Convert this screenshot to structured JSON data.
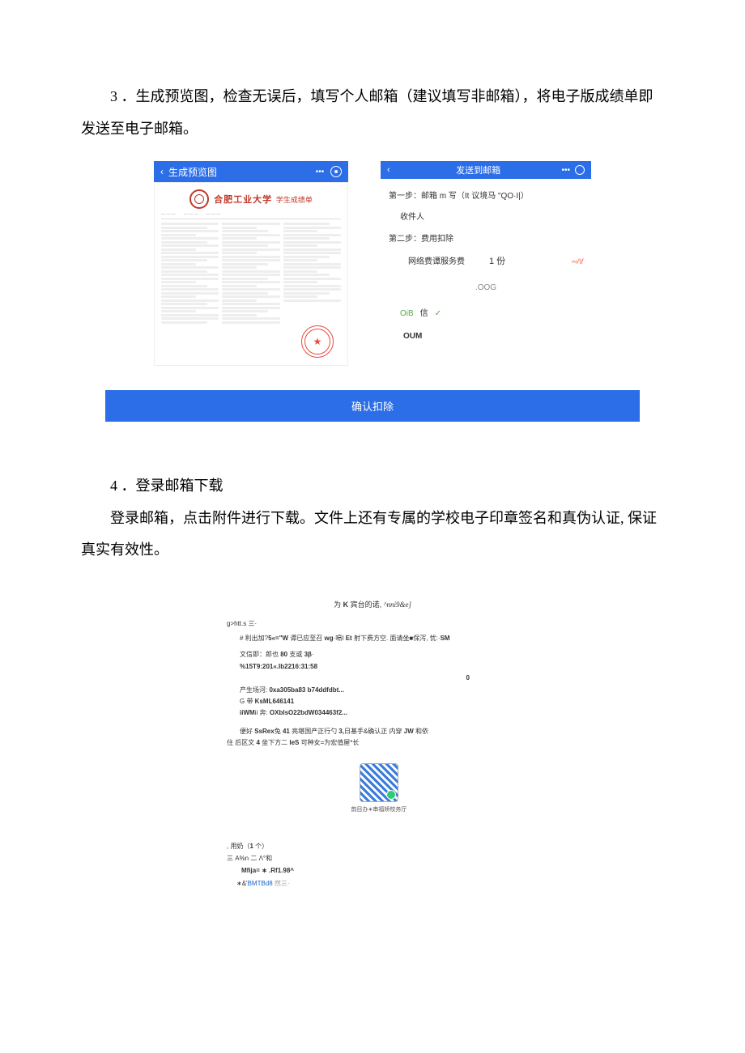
{
  "step3": {
    "para": "3 ．生成预览图，检查无误后，填写个人邮箱（建议填写非邮箱），将电子版成绩单即发送至电子邮箱。"
  },
  "preview": {
    "back": "‹",
    "header_title": "生成预览图",
    "dots": "•••",
    "university": "合肥工业大学",
    "sub": "学生成绩单"
  },
  "mail": {
    "back": "‹",
    "header_title": "发送到邮箱",
    "dots": "•••",
    "step1_label": "第一步：邮箱 m 写（It 议境马 \"QO·I|）",
    "recipient_label": "收件人",
    "step2_label": "第二步：费用扣除",
    "fee_name": "网络费谭服务费",
    "fee_qty": "1 份",
    "fee_price": "∾/\\f",
    "oog": ".OOG",
    "oib": "OiB",
    "oib_lab": "信",
    "check": "✓",
    "oum": "OUM"
  },
  "confirm_label": "确认扣除",
  "step4": {
    "title": "4 ．登录邮箱下载",
    "para": "登录邮箱，点击附件进行下载。文件上还有专属的学校电子印章签名和真伪认证, 保证真实有效性。"
  },
  "email": {
    "title_pre": "为",
    "title_k": "K",
    "title_mid": "宾台的诺,",
    "title_code": "^nni9&e]",
    "greet": "g>htt.s 三·",
    "line1_pre": "# 利出加?",
    "line1_b1": "5«=\"W",
    "line1_mid": " 谭已应至召 ",
    "line1_b2": "wg",
    "line1_mid2": "·嗝I ",
    "line1_b3": "Et",
    "line1_mid3": " 射下费方空. 面请坐■保泻, 忧:·",
    "line1_b4": "SM",
    "line2_pre": "文信即：郎也 ",
    "line2_b1": "80",
    "line2_mid": " 支或 ",
    "line2_b2": "3β",
    "line2_suf": "·",
    "line3": "%15T9:201«.Ib2216:31:58",
    "zero": "0",
    "line4_pre": "产生场河: ",
    "line4_b": "0xa305ba83 b74ddfdbt...",
    "line5_pre": "G 带 ",
    "line5_b": "KsML646141",
    "line6_pre": "iiWM",
    "line6_mid": "ii 奔: ",
    "line6_b": "OXblsO22bdW034463f2...",
    "line7_pre": "便好 ",
    "line7_b1": "SsRex",
    "line7_mid1": "兔 ",
    "line7_b2": "41",
    "line7_mid2": " 亮堪国产正行勺 ",
    "line7_b3": "3,",
    "line7_mid3": "日基手&确认正 内穿 ",
    "line7_b4": "JW",
    "line7_suf": " 和依",
    "line8_pre": "住 后区文 ",
    "line8_b1": "4",
    "line8_mid": " 坐下方二 ",
    "line8_b2": "IeS",
    "line8_suf": " 可种女=为宏值屋*长",
    "qr_cap": "韵目办∗串福矫校务厅",
    "attach_pre": ", 用奶（",
    "attach_b": "1",
    "attach_suf": " 个）",
    "attach_file_pre": "三 ",
    "attach_file_b": "A%n",
    "attach_file_suf": " 二 Λ°和",
    "fname": "Mfija= ∗ .Rf1.98^",
    "link_pre": "∗&'",
    "link_txt": "BMTBd8",
    "link_suf": " 然三·"
  }
}
